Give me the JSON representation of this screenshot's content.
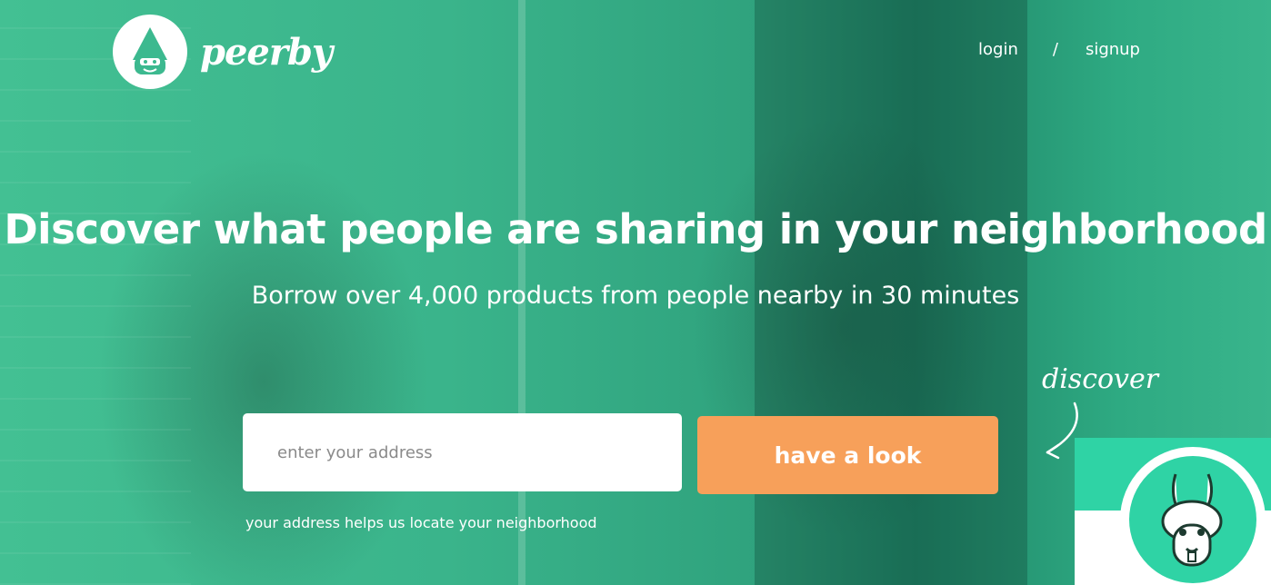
{
  "brand": {
    "name": "peerby"
  },
  "nav": {
    "login": "login",
    "separator": "/",
    "signup": "signup"
  },
  "hero": {
    "headline": "Discover what people are sharing in your neighborhood",
    "subline": "Borrow over 4,000 products from people nearby in 30 minutes"
  },
  "search": {
    "placeholder": "enter your address",
    "button_label": "have a look",
    "helper": "your address helps us locate your neighborhood"
  },
  "discover": {
    "note": "discover"
  },
  "colors": {
    "brand_green": "#3cb98f",
    "button_orange": "#f7a05a",
    "widget_green": "#2fd3a5"
  },
  "icons": {
    "logo": "gnome-face-icon",
    "arrow": "curved-arrow-icon",
    "widget": "llama-icon"
  }
}
